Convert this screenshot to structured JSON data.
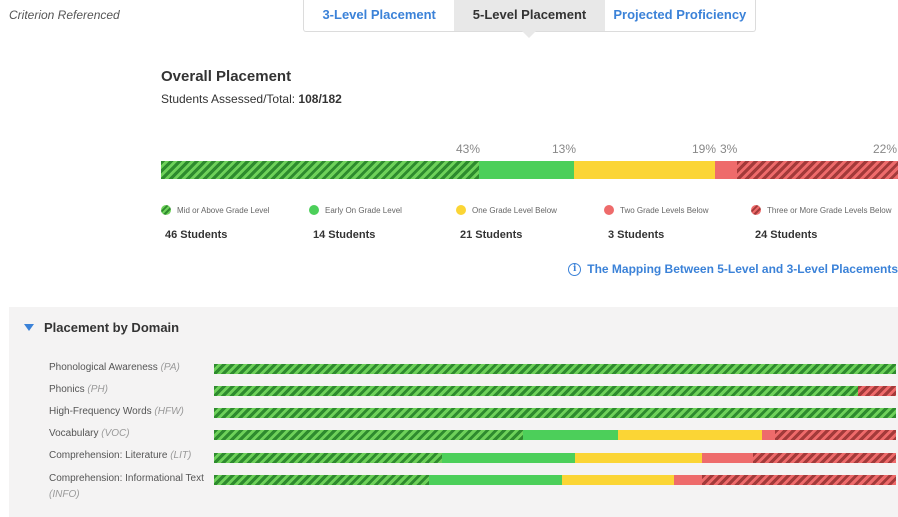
{
  "criterion": "Criterion Referenced",
  "tabs": [
    {
      "label": "3-Level Placement"
    },
    {
      "label": "5-Level Placement"
    },
    {
      "label": "Projected Proficiency"
    }
  ],
  "overall": {
    "title": "Overall Placement",
    "assessed_label": "Students Assessed/Total: ",
    "assessed_value": "108/182",
    "percents": [
      "43%",
      "13%",
      "19%",
      "3%",
      "22%"
    ]
  },
  "legend": [
    {
      "label": "Mid or Above Grade Level",
      "count": "46 Students",
      "color": "#2e8b2e"
    },
    {
      "label": "Early On Grade Level",
      "count": "14 Students",
      "color": "#4ccf5a"
    },
    {
      "label": "One Grade Level Below",
      "count": "21 Students",
      "color": "#fbd535"
    },
    {
      "label": "Two Grade Levels Below",
      "count": "3 Students",
      "color": "#ee6b6b"
    },
    {
      "label": "Three or More Grade Levels Below",
      "count": "24 Students",
      "color": "#a33a3a"
    }
  ],
  "mapping_link": "The Mapping Between 5-Level and 3-Level Placements",
  "domain": {
    "header": "Placement by Domain",
    "rows": [
      {
        "name": "Phonological Awareness",
        "abbr": "(PA)",
        "shares": [
          1.0,
          0,
          0,
          0,
          0
        ]
      },
      {
        "name": "Phonics",
        "abbr": "(PH)",
        "shares": [
          0.945,
          0,
          0,
          0,
          0.055
        ]
      },
      {
        "name": "High-Frequency Words",
        "abbr": "(HFW)",
        "shares": [
          1.0,
          0,
          0,
          0,
          0
        ]
      },
      {
        "name": "Vocabulary",
        "abbr": "(VOC)",
        "shares": [
          0.453,
          0.14,
          0.21,
          0.02,
          0.177
        ]
      },
      {
        "name": "Comprehension: Literature",
        "abbr": "(LIT)",
        "shares": [
          0.335,
          0.195,
          0.185,
          0.075,
          0.21
        ]
      },
      {
        "name": "Comprehension: Informational Text",
        "abbr": "(INFO)",
        "shares": [
          0.315,
          0.195,
          0.165,
          0.04,
          0.285
        ]
      }
    ]
  }
}
